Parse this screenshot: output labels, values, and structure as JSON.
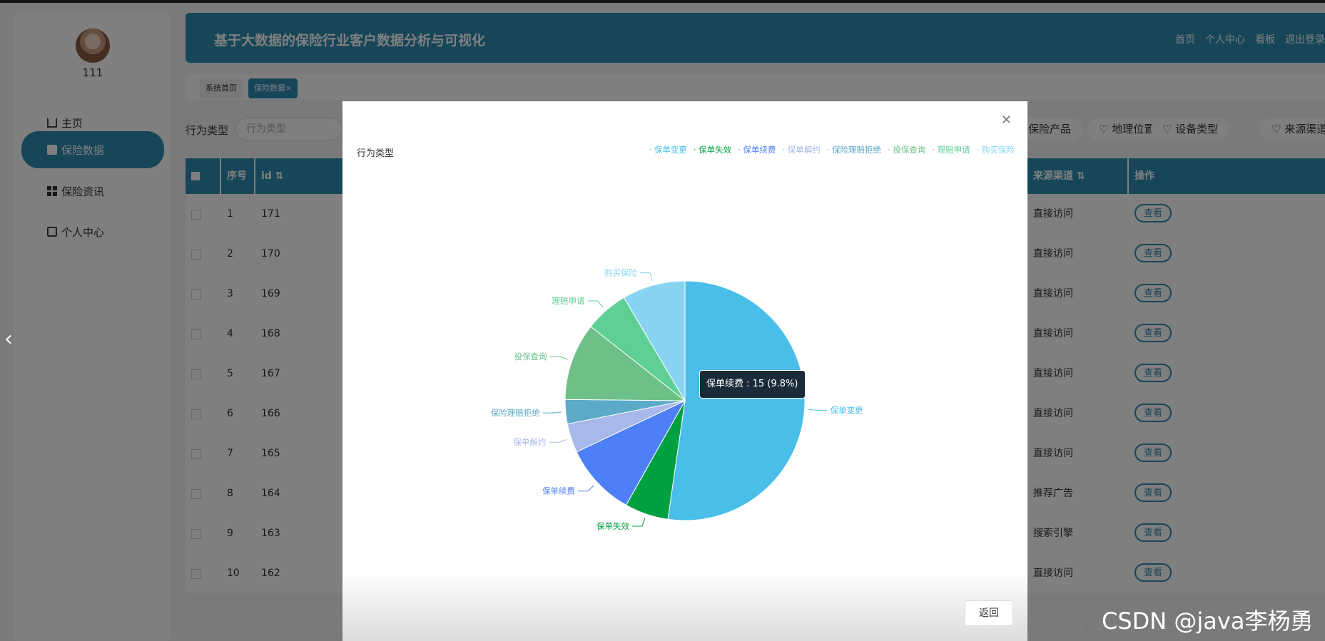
{
  "sidebar": {
    "username": "111",
    "items": [
      {
        "label": "主页"
      },
      {
        "label": "保险数据"
      },
      {
        "label": "保险资讯"
      },
      {
        "label": "个人中心"
      }
    ]
  },
  "header": {
    "title": "基于大数据的保险行业客户数据分析与可视化",
    "nav": [
      "首页",
      "个人中心",
      "看板",
      "退出登录"
    ]
  },
  "tabs": [
    {
      "label": "系统首页"
    },
    {
      "label": "保险数据×"
    }
  ],
  "filter": {
    "label": "行为类型",
    "placeholder": "行为类型",
    "chips": [
      "保险产品",
      "地理位置",
      "设备类型",
      "来源渠道"
    ]
  },
  "table": {
    "headers": {
      "seq": "序号",
      "id": "id",
      "source": "来源渠道",
      "op": "操作"
    },
    "view_label": "查看",
    "rows": [
      {
        "seq": "1",
        "id": "171",
        "source": "直接访问"
      },
      {
        "seq": "2",
        "id": "170",
        "source": "直接访问"
      },
      {
        "seq": "3",
        "id": "169",
        "source": "直接访问"
      },
      {
        "seq": "4",
        "id": "168",
        "source": "直接访问"
      },
      {
        "seq": "5",
        "id": "167",
        "source": "直接访问"
      },
      {
        "seq": "6",
        "id": "166",
        "source": "直接访问"
      },
      {
        "seq": "7",
        "id": "165",
        "source": "直接访问"
      },
      {
        "seq": "8",
        "id": "164",
        "source": "推荐广告"
      },
      {
        "seq": "9",
        "id": "163",
        "source": "搜索引擎"
      },
      {
        "seq": "10",
        "id": "162",
        "source": "直接访问"
      }
    ]
  },
  "pagination": [
    "2",
    "3",
    "4",
    "5",
    "6"
  ],
  "modal": {
    "title": "行为类型",
    "back_label": "返回",
    "tooltip": "保单续费 : 15 (9.8%)"
  },
  "chart_data": {
    "type": "pie",
    "title": "行为类型",
    "legend_position": "top-right",
    "slices": [
      {
        "name": "保单变更",
        "value": 80,
        "color": "#48bee8"
      },
      {
        "name": "保单失效",
        "value": 9,
        "color": "#00a040"
      },
      {
        "name": "保单续费",
        "value": 15,
        "color": "#4d7ff7"
      },
      {
        "name": "保单解约",
        "value": 6,
        "color": "#a8b8ea"
      },
      {
        "name": "保险理赔拒绝",
        "value": 5,
        "color": "#5aaac8"
      },
      {
        "name": "投保查询",
        "value": 16,
        "color": "#6cc088"
      },
      {
        "name": "理赔申请",
        "value": 9,
        "color": "#5ed096"
      },
      {
        "name": "购买保险",
        "value": 13,
        "color": "#88d4f0"
      }
    ]
  },
  "watermark": "CSDN @java李杨勇"
}
